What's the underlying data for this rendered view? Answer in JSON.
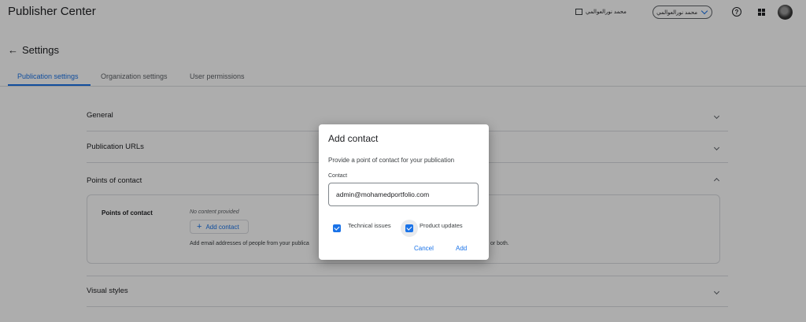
{
  "header": {
    "app_title": "Publisher Center",
    "publication_name": "محمد نورالعوالمي",
    "selected_publication": "محمد نورالعوالمي",
    "help_icon": "help-circle-icon",
    "apps_icon": "apps-grid-icon"
  },
  "page": {
    "back_icon": "arrow-back-icon",
    "title": "Settings"
  },
  "tabs": [
    {
      "label": "Publication settings",
      "active": true
    },
    {
      "label": "Organization settings",
      "active": false
    },
    {
      "label": "User permissions",
      "active": false
    }
  ],
  "sections": {
    "general": "General",
    "publication_urls": "Publication URLs",
    "points_of_contact": "Points of contact",
    "visual_styles": "Visual styles"
  },
  "poc_card": {
    "label": "Points of contact",
    "empty_text": "No content provided",
    "add_button": "Add contact",
    "helper_left": "Add email addresses of people from your publica",
    "helper_right": "or both."
  },
  "dialog": {
    "title": "Add contact",
    "subtitle": "Provide a point of contact for your publication",
    "field_label": "Contact",
    "field_value": "admin@mohamedportfolio.com",
    "checkbox_1": {
      "label": "Technical issues",
      "checked": true
    },
    "checkbox_2": {
      "label": "Product updates",
      "checked": true
    },
    "cancel_label": "Cancel",
    "add_label": "Add"
  },
  "colors": {
    "accent": "#1a73e8",
    "scrim": "rgba(0,0,0,0.32)"
  }
}
